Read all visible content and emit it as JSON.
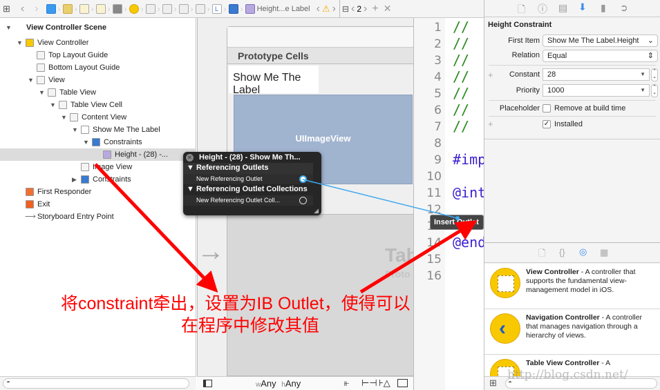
{
  "toolbar": {
    "breadcrumb_last": "Height...e Label",
    "editor_counter": "2"
  },
  "outline": {
    "rows": [
      {
        "label": "View Controller Scene",
        "level": 0,
        "expanded": true,
        "icon": "scene-icon"
      },
      {
        "label": "View Controller",
        "level": 1,
        "expanded": true,
        "icon": "view-controller-icon"
      },
      {
        "label": "Top Layout Guide",
        "level": 2,
        "icon": "layout-guide-icon"
      },
      {
        "label": "Bottom Layout Guide",
        "level": 2,
        "icon": "layout-guide-icon"
      },
      {
        "label": "View",
        "level": 2,
        "expanded": true,
        "icon": "view-icon"
      },
      {
        "label": "Table View",
        "level": 3,
        "expanded": true,
        "icon": "table-view-icon"
      },
      {
        "label": "Table View Cell",
        "level": 4,
        "expanded": true,
        "icon": "table-cell-icon"
      },
      {
        "label": "Content View",
        "level": 5,
        "expanded": true,
        "icon": "view-icon"
      },
      {
        "label": "Show Me The Label",
        "level": 6,
        "expanded": true,
        "icon": "label-icon"
      },
      {
        "label": "Constraints",
        "level": 7,
        "expanded": true,
        "icon": "constraints-icon"
      },
      {
        "label": "Height - (28) -...",
        "level": 8,
        "selected": true,
        "icon": "constraint-icon"
      },
      {
        "label": "Image View",
        "level": 6,
        "icon": "image-view-icon"
      },
      {
        "label": "Constraints",
        "level": 6,
        "expanded": false,
        "icon": "constraints-icon"
      },
      {
        "label": "First Responder",
        "level": 1,
        "icon": "first-responder-icon"
      },
      {
        "label": "Exit",
        "level": 1,
        "icon": "exit-icon"
      },
      {
        "label": "Storyboard Entry Point",
        "level": 1,
        "icon": "arrow-icon"
      }
    ]
  },
  "canvas": {
    "prototype_cells": "Prototype Cells",
    "cell_label": "Show Me The Label",
    "image_view": "UIImageView",
    "table_placeholder": "Tab",
    "table_placeholder_sub": "Proto",
    "size_w_prefix": "w",
    "size_w": "Any",
    "size_h_prefix": "h",
    "size_h": "Any"
  },
  "popup": {
    "title": "Height - (28) - Show Me Th...",
    "section1": "Referencing Outlets",
    "item1": "New Referencing Outlet",
    "section2": "Referencing Outlet Collections",
    "item2": "New Referencing Outlet Coll..."
  },
  "insert_outlet": "Insert Outlet",
  "editor": {
    "lines": [
      "1",
      "2",
      "3",
      "4",
      "5",
      "6",
      "7",
      "8",
      "9",
      "10",
      "11",
      "12",
      "13",
      "14",
      "15",
      "16"
    ],
    "code": [
      {
        "line": 1,
        "text": "//",
        "color": "#2a8a1e"
      },
      {
        "line": 2,
        "text": "//",
        "color": "#2a8a1e"
      },
      {
        "line": 3,
        "text": "//",
        "color": "#2a8a1e"
      },
      {
        "line": 4,
        "text": "//",
        "color": "#2a8a1e"
      },
      {
        "line": 5,
        "text": "//",
        "color": "#2a8a1e"
      },
      {
        "line": 6,
        "text": "//",
        "color": "#2a8a1e"
      },
      {
        "line": 7,
        "text": "//",
        "color": "#2a8a1e"
      },
      {
        "line": 9,
        "text": "#imp",
        "color": "#3a1fd0"
      },
      {
        "line": 11,
        "text": "@int",
        "color": "#3a1fd0"
      },
      {
        "line": 14,
        "text": "@end",
        "color": "#3a1fd0"
      }
    ]
  },
  "inspector": {
    "title": "Height Constraint",
    "first_item_label": "First Item",
    "first_item": "Show Me The Label.Height",
    "relation_label": "Relation",
    "relation": "Equal",
    "constant_label": "Constant",
    "constant": "28",
    "priority_label": "Priority",
    "priority": "1000",
    "placeholder_label": "Placeholder",
    "remove_label": "Remove at build time",
    "remove_checked": false,
    "installed_label": "Installed",
    "installed_checked": true
  },
  "library": {
    "items": [
      {
        "name": "View Controller",
        "desc": " - A controller that supports the fundamental view-management model in iOS."
      },
      {
        "name": "Navigation Controller",
        "desc": " - A controller that manages navigation through a hierarchy of views."
      },
      {
        "name": "Table View Controller",
        "desc": " - A"
      }
    ]
  },
  "annotation": {
    "line1": "将constraint牵出，设置为IB Outlet，使得可以",
    "line2": "在程序中修改其值",
    "color": "#ff0000"
  },
  "watermark": "http://blog.csdn.net/"
}
